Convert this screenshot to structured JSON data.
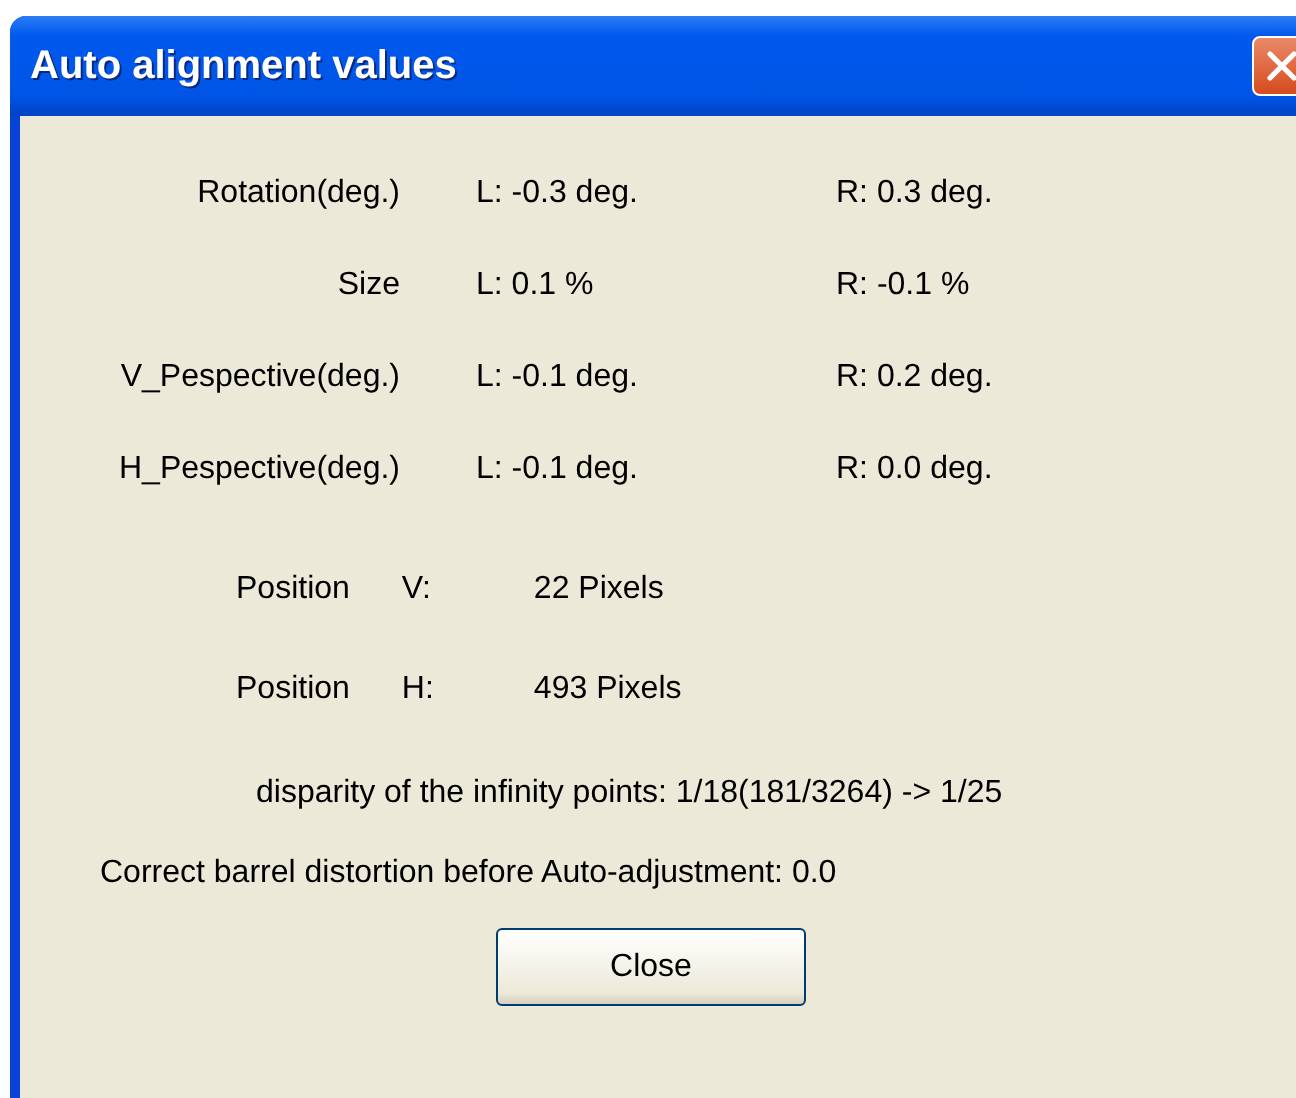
{
  "window": {
    "title": "Auto alignment values"
  },
  "measurements": [
    {
      "label": "Rotation(deg.)",
      "left": "L: -0.3 deg.",
      "right": "R: 0.3 deg."
    },
    {
      "label": "Size",
      "left": "L: 0.1 %",
      "right": "R: -0.1 %"
    },
    {
      "label": "V_Pespective(deg.)",
      "left": "L: -0.1 deg.",
      "right": "R: 0.2 deg."
    },
    {
      "label": "H_Pespective(deg.)",
      "left": "L: -0.1 deg.",
      "right": "R: 0.0 deg."
    }
  ],
  "positions": [
    {
      "label": "Position",
      "axis": "V:",
      "value": "22 Pixels"
    },
    {
      "label": "Position",
      "axis": "H:",
      "value": "493 Pixels"
    }
  ],
  "disparity": "disparity of the infinity points: 1/18(181/3264) -> 1/25",
  "barrel": "Correct barrel distortion before Auto-adjustment: 0.0",
  "buttons": [
    "Close"
  ]
}
